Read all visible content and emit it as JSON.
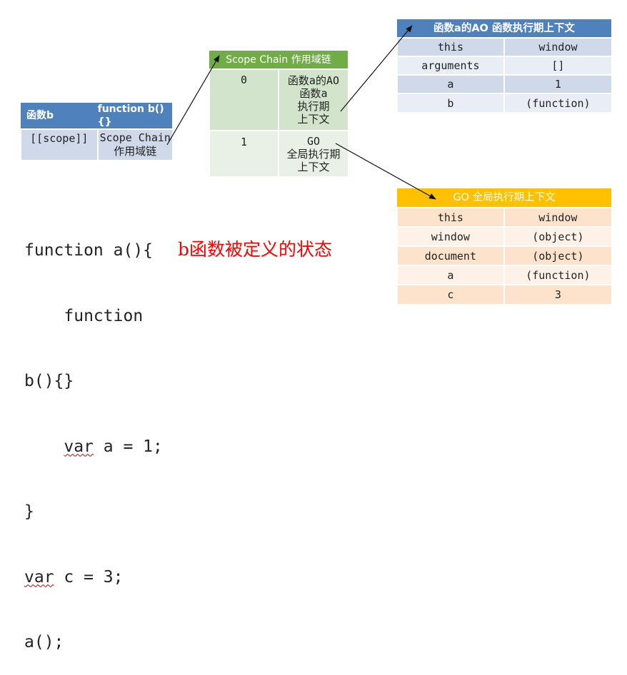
{
  "table_b": {
    "header_left": "函数b",
    "header_right": "function b(){}",
    "row_key": "[[scope]]",
    "row_value_line1": "Scope Chain",
    "row_value_line2": "作用域链"
  },
  "scope_chain": {
    "title": "Scope Chain 作用域链",
    "rows": [
      {
        "index": "0",
        "lines": [
          "函数a的AO",
          "函数a",
          "执行期",
          "上下文"
        ]
      },
      {
        "index": "1",
        "lines": [
          "GO",
          "全局执行期",
          "上下文"
        ]
      }
    ]
  },
  "ao_table": {
    "title": "函数a的AO 函数执行期上下文",
    "rows": [
      {
        "key": "this",
        "value": "window"
      },
      {
        "key": "arguments",
        "value": "[]"
      },
      {
        "key": "a",
        "value": "1"
      },
      {
        "key": "b",
        "value": "(function)"
      }
    ]
  },
  "go_table": {
    "title": "GO 全局执行期上下文",
    "rows": [
      {
        "key": "this",
        "value": "window"
      },
      {
        "key": "window",
        "value": "(object)"
      },
      {
        "key": "document",
        "value": "(object)"
      },
      {
        "key": "a",
        "value": "(function)"
      },
      {
        "key": "c",
        "value": "3"
      }
    ]
  },
  "code_lines": [
    "function a(){",
    "    function",
    "b(){}",
    "    var a = 1;",
    "}",
    "var c = 3;",
    "a();"
  ],
  "caption": "b函数被定义的状态",
  "colors": {
    "blue_header": "#4f81bd",
    "green_header": "#70ad47",
    "orange_header": "#ffc000",
    "caption": "#ff0000"
  }
}
